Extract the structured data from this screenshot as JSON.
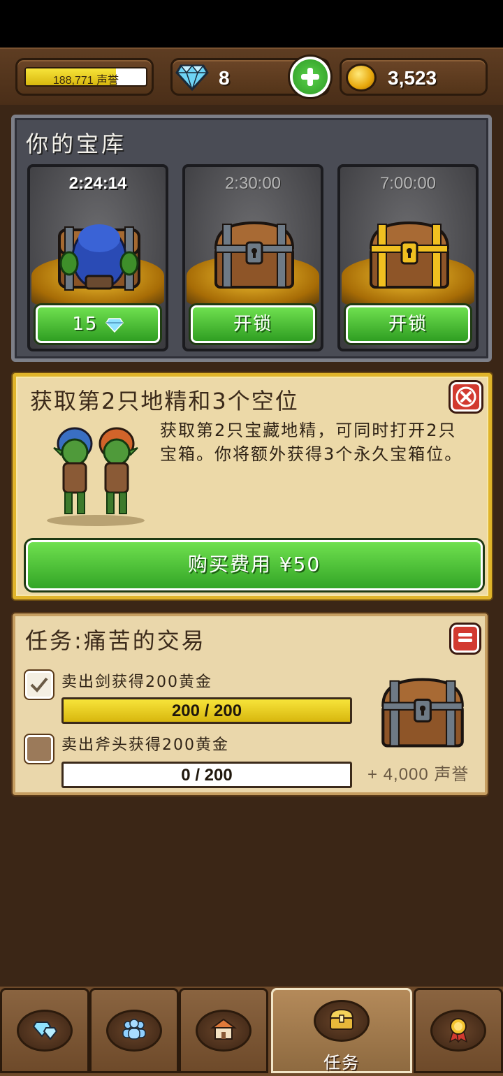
{
  "top_bar": {
    "reputation_text": "188,771 声誉",
    "reputation_progress": 0.75,
    "gems": "8",
    "gold": "3,523",
    "icons": [
      "diamond-icon",
      "plus-icon",
      "gold-coin-icon"
    ]
  },
  "vault": {
    "title": "你的宝库",
    "slots": [
      {
        "timer": "2:24:14",
        "state": "opening",
        "button_label": "15",
        "button_icon": "diamond-icon",
        "chest": "wooden"
      },
      {
        "timer": "2:30:00",
        "state": "locked",
        "button_label": "开锁",
        "chest": "wooden"
      },
      {
        "timer": "7:00:00",
        "state": "locked",
        "button_label": "开锁",
        "chest": "golden"
      }
    ]
  },
  "offer": {
    "title": "获取第2只地精和3个空位",
    "description": "获取第2只宝藏地精，可同时打开2只宝箱。你将额外获得3个永久宝箱位。",
    "buy_label": "购买费用 ¥50"
  },
  "quest": {
    "title": "任务:痛苦的交易",
    "tasks": [
      {
        "label": "卖出剑获得200黄金",
        "progress_text": "200 / 200",
        "progress": 1.0,
        "checked": true
      },
      {
        "label": "卖出斧头获得200黄金",
        "progress_text": "0 / 200",
        "progress": 0.0,
        "checked": false
      }
    ],
    "reward": "+ 4,000 声誉"
  },
  "nav": {
    "tabs": [
      {
        "icon": "gems-icon",
        "label": ""
      },
      {
        "icon": "people-icon",
        "label": ""
      },
      {
        "icon": "shop-icon",
        "label": ""
      },
      {
        "icon": "chest-icon",
        "label": "任务",
        "active": true
      },
      {
        "icon": "medal-icon",
        "label": ""
      }
    ]
  }
}
